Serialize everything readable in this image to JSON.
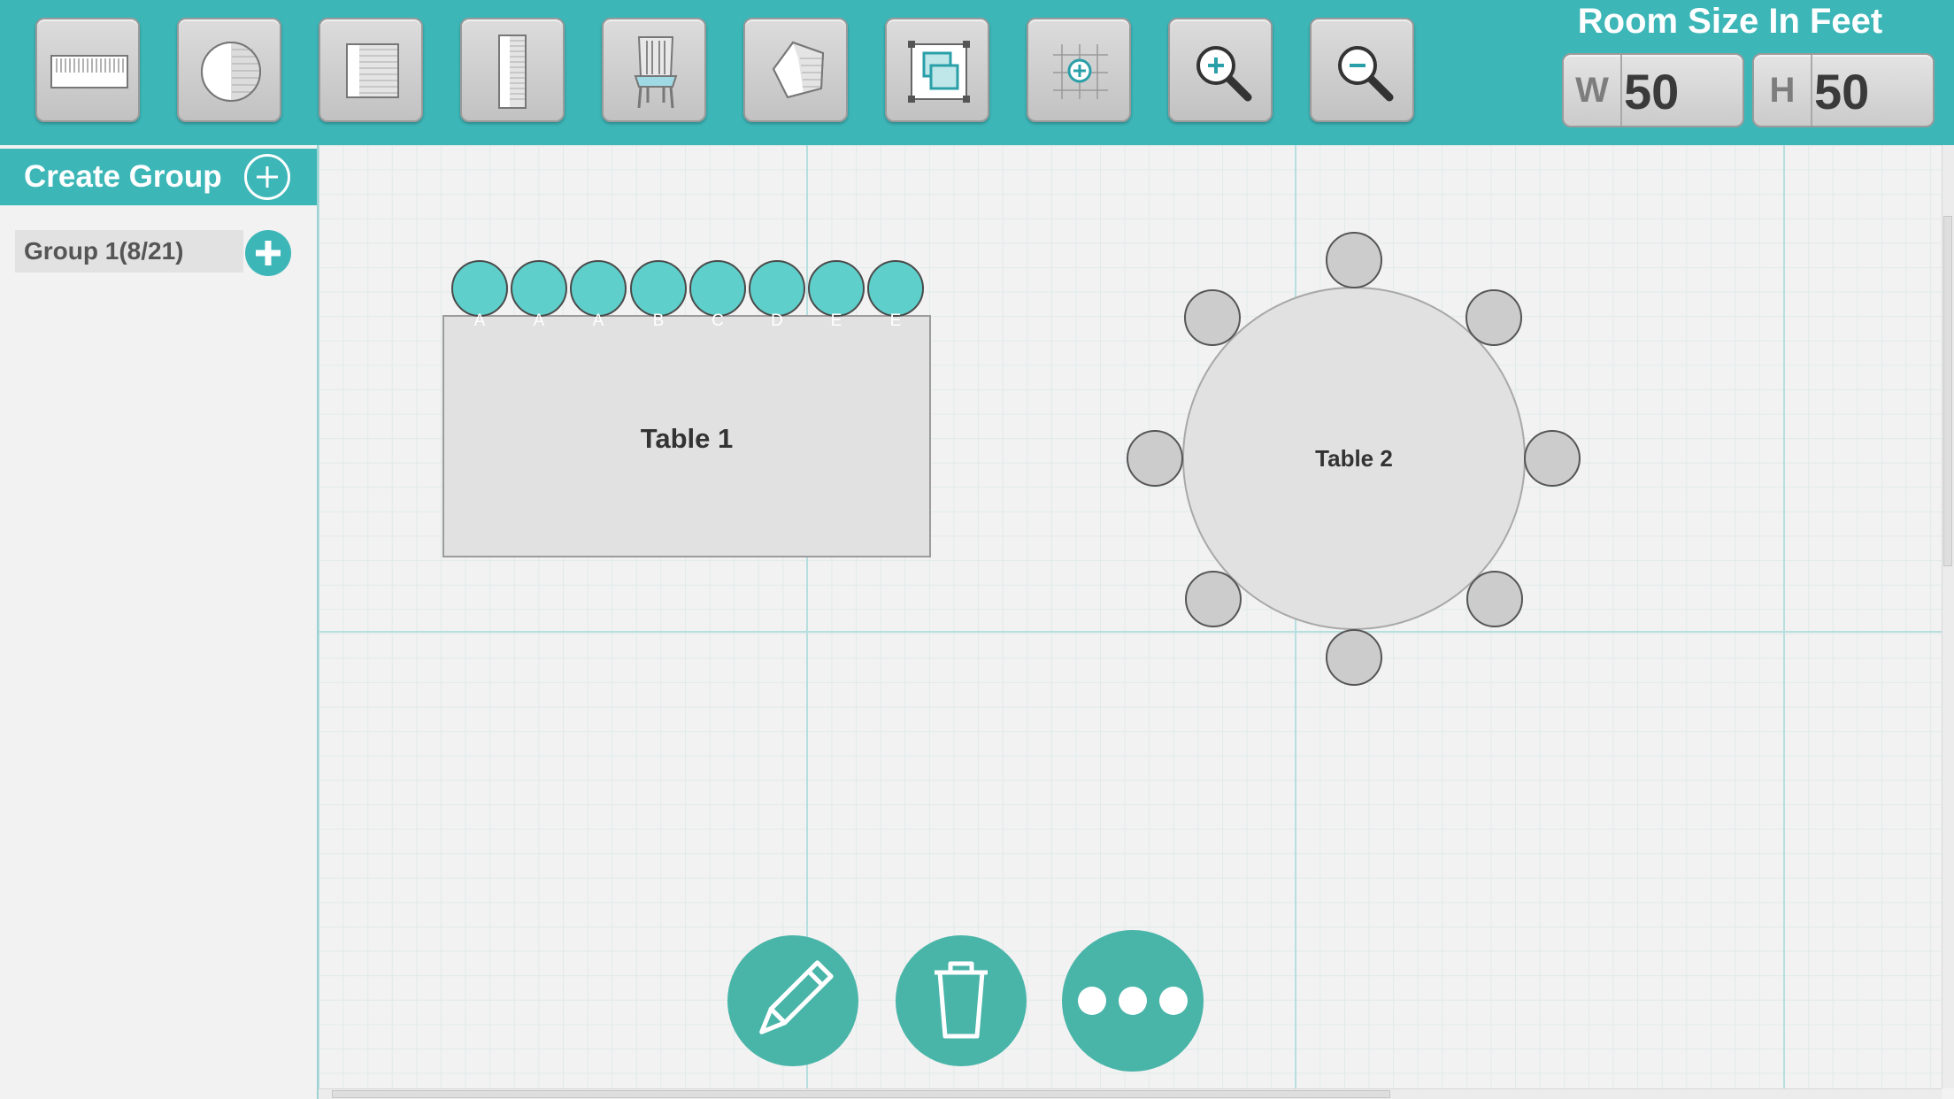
{
  "toolbar": {
    "tools": [
      {
        "icon": "rectangle-table-icon"
      },
      {
        "icon": "round-table-icon"
      },
      {
        "icon": "square-table-icon"
      },
      {
        "icon": "tall-table-icon"
      },
      {
        "icon": "chair-icon"
      },
      {
        "icon": "pentagon-shape-icon"
      },
      {
        "icon": "group-frame-icon"
      },
      {
        "icon": "grid-add-icon"
      },
      {
        "icon": "zoom-in-icon"
      },
      {
        "icon": "zoom-out-icon"
      }
    ]
  },
  "room": {
    "title": "Room Size In Feet",
    "width_prefix": "W",
    "width_value": "50",
    "height_prefix": "H",
    "height_value": "50"
  },
  "sidebar": {
    "create_group_label": "Create Group",
    "groups": [
      {
        "label": "Group 1(8/21)"
      }
    ]
  },
  "canvas": {
    "tables": [
      {
        "label": "Table 1",
        "shape": "rectangle",
        "seats": [
          {
            "letter": "A",
            "assigned": true
          },
          {
            "letter": "A",
            "assigned": true
          },
          {
            "letter": "A",
            "assigned": true
          },
          {
            "letter": "B",
            "assigned": true
          },
          {
            "letter": "C",
            "assigned": true
          },
          {
            "letter": "D",
            "assigned": true
          },
          {
            "letter": "E",
            "assigned": true
          },
          {
            "letter": "E",
            "assigned": true
          }
        ]
      },
      {
        "label": "Table 2",
        "shape": "round",
        "seat_count": 8
      }
    ]
  },
  "actions": [
    {
      "icon": "pencil-icon"
    },
    {
      "icon": "trash-icon"
    },
    {
      "icon": "more-dots-icon"
    }
  ],
  "colors": {
    "accent": "#3db6b8",
    "seat_assigned": "#5fcfcb",
    "seat_empty": "#cccccc",
    "action_button": "#49b4a8"
  }
}
